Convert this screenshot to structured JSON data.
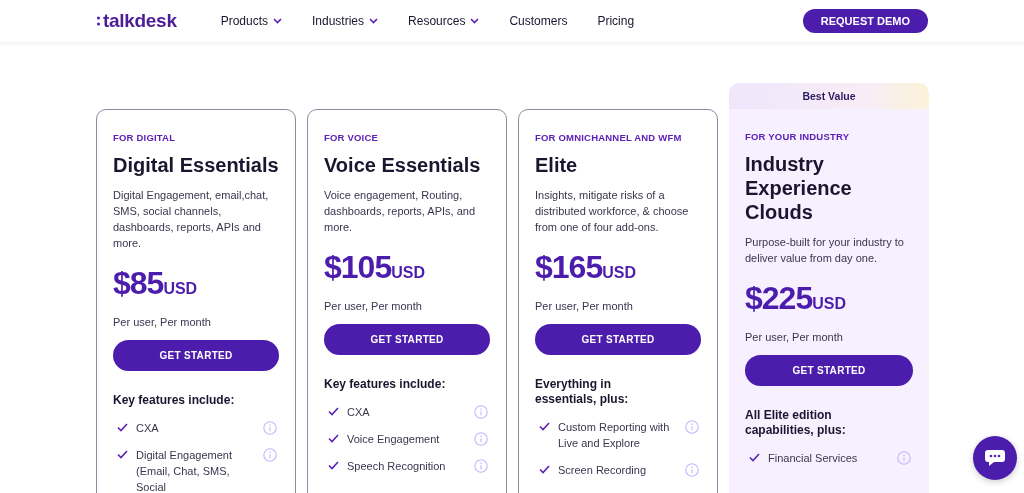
{
  "nav": {
    "logo": "talkdesk",
    "links": [
      {
        "label": "Products",
        "dropdown": true
      },
      {
        "label": "Industries",
        "dropdown": true
      },
      {
        "label": "Resources",
        "dropdown": true
      },
      {
        "label": "Customers",
        "dropdown": false
      },
      {
        "label": "Pricing",
        "dropdown": false
      }
    ],
    "cta": "REQUEST DEMO"
  },
  "plans": [
    {
      "eyebrow": "FOR DIGITAL",
      "name": "Digital Essentials",
      "description": "Digital Engagement, email,chat, SMS, social channels, dashboards, reports, APIs and more.",
      "price": "$85",
      "currency": "USD",
      "period": "Per user, Per month",
      "button": "GET STARTED",
      "features_heading": "Key features include:",
      "features": [
        "CXA",
        "Digital Engagement (Email, Chat, SMS, Social"
      ]
    },
    {
      "eyebrow": "FOR VOICE",
      "name": "Voice Essentials",
      "description": "Voice engagement, Routing, dashboards, reports, APIs, and more.",
      "price": "$105",
      "currency": "USD",
      "period": "Per user, Per month",
      "button": "GET STARTED",
      "features_heading": "Key features include:",
      "features": [
        "CXA",
        "Voice Engagement",
        "Speech Recognition"
      ]
    },
    {
      "eyebrow": "FOR OMNICHANNEL AND WFM",
      "name": "Elite",
      "description": "Insights, mitigate risks of a distributed workforce, & choose from one of four add-ons.",
      "price": "$165",
      "currency": "USD",
      "period": "Per user, Per month",
      "button": "GET STARTED",
      "features_heading": "Everything in essentials, plus:",
      "features": [
        "Custom Reporting with Live and Explore",
        "Screen Recording"
      ]
    },
    {
      "badge": "Best Value",
      "eyebrow": "FOR YOUR INDUSTRY",
      "name": "Industry Experience Clouds",
      "description": "Purpose-built for your industry to deliver value from day one.",
      "price": "$225",
      "currency": "USD",
      "period": "Per user, Per month",
      "button": "GET STARTED",
      "features_heading": "All Elite edition capabilities, plus:",
      "features": [
        "Financial Services"
      ]
    }
  ]
}
